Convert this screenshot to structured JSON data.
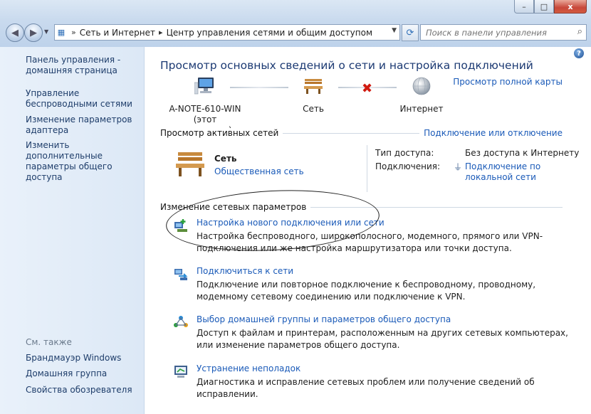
{
  "window": {
    "caption_buttons": {
      "minimize": "–",
      "maximize": "□",
      "close": "x"
    },
    "close_color": "#c8473a"
  },
  "nav": {
    "address": {
      "separator": "»",
      "crumbs": [
        "Сеть и Интернет",
        "Центр управления сетями и общим доступом"
      ],
      "crumb_separator": "▸"
    },
    "search": {
      "placeholder": "Поиск в панели управления"
    }
  },
  "sidebar": {
    "home": "Панель управления - домашняя страница",
    "items": [
      "Управление беспроводными сетями",
      "Изменение параметров адаптера",
      "Изменить дополнительные параметры общего доступа"
    ],
    "see_also": {
      "title": "См. также",
      "items": [
        "Брандмауэр Windows",
        "Домашняя группа",
        "Свойства обозревателя"
      ]
    }
  },
  "main": {
    "help": "?",
    "title": "Просмотр основных сведений о сети и настройка подключений",
    "full_map": "Просмотр полной карты",
    "map": {
      "computer_name": "A-NOTE-610-WIN",
      "computer_note": "(этот компьютер)",
      "network": "Сеть",
      "internet": "Интернет",
      "broken_link": "✖"
    },
    "active": {
      "title": "Просмотр активных сетей",
      "connect_link": "Подключение или отключение",
      "network_name": "Сеть",
      "network_type": "Общественная сеть",
      "access_label": "Тип доступа:",
      "access_value": "Без доступа к Интернету",
      "connections_label": "Подключения:",
      "connections_value": "Подключение по локальной сети"
    },
    "change": {
      "title": "Изменение сетевых параметров",
      "tasks": [
        {
          "link": "Настройка нового подключения или сети",
          "desc": "Настройка беспроводного, широкополосного, модемного, прямого или VPN-подключения или же настройка маршрутизатора или точки доступа."
        },
        {
          "link": "Подключиться к сети",
          "desc": "Подключение или повторное подключение к беспроводному, проводному, модемному сетевому соединению или подключение к VPN."
        },
        {
          "link": "Выбор домашней группы и параметров общего доступа",
          "desc": "Доступ к файлам и принтерам, расположенным на других сетевых компьютерах, или изменение параметров общего доступа."
        },
        {
          "link": "Устранение неполадок",
          "desc": "Диагностика и исправление сетевых проблем или получение сведений об исправлении."
        }
      ]
    }
  },
  "colors": {
    "link": "#1a5ab8",
    "title": "#1c3a73",
    "sidebar_bg": "#dce8f6"
  }
}
